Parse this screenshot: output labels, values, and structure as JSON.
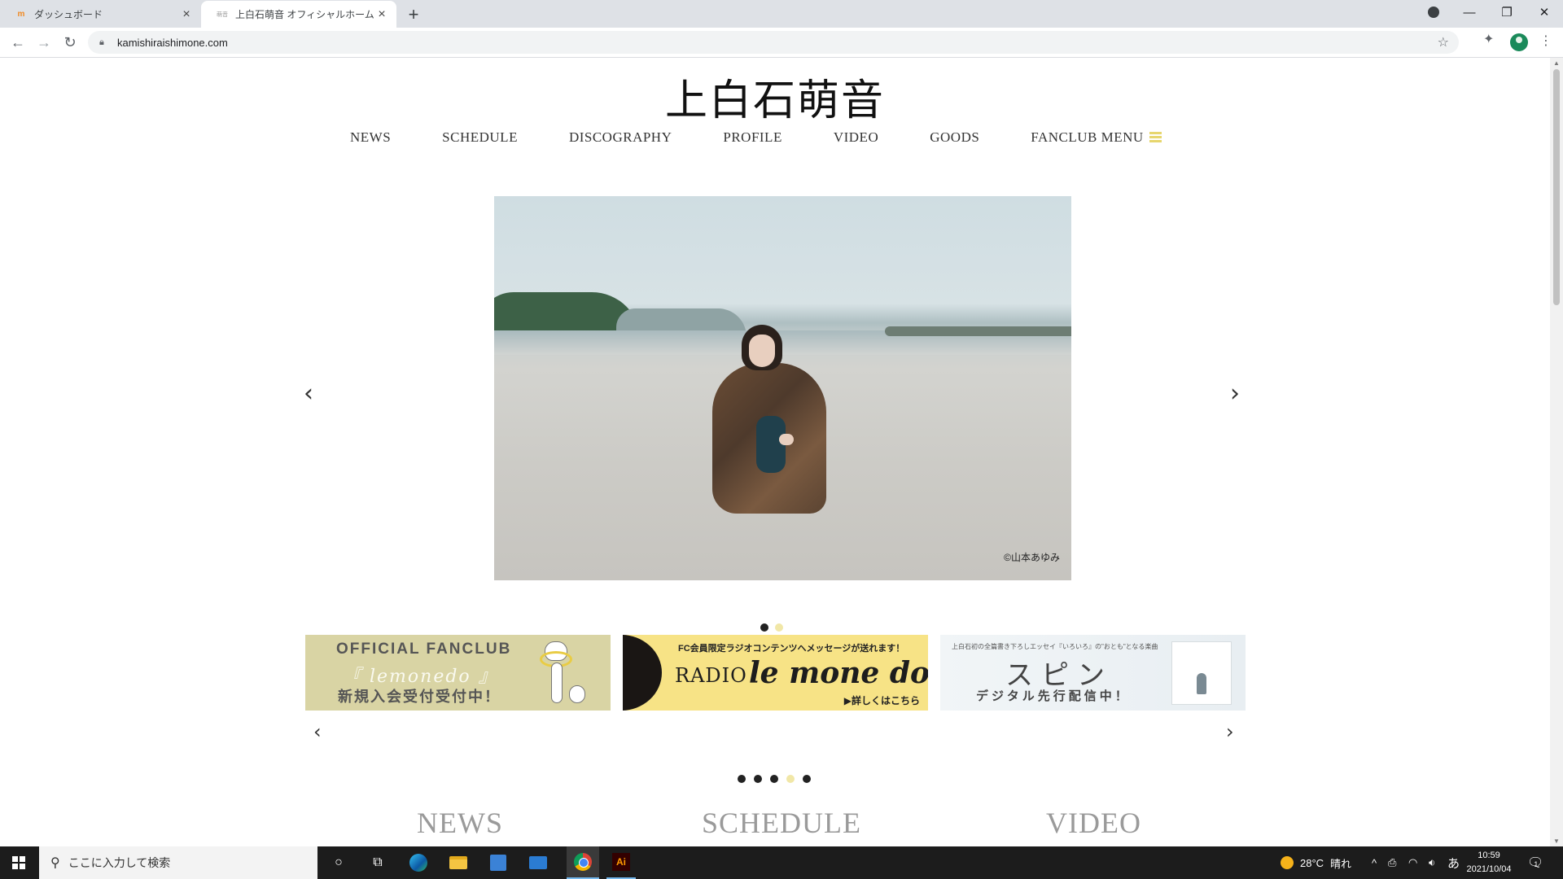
{
  "browser": {
    "tabs": [
      {
        "title": "ダッシュボード",
        "favicon": "wordpress-dashboard-icon"
      },
      {
        "title": "上白石萌音 オフィシャルホームページ",
        "favicon": "site-icon",
        "active": true
      }
    ],
    "url": "kamishiraishimone.com"
  },
  "site": {
    "logo": "上白石萌音",
    "nav": [
      "NEWS",
      "SCHEDULE",
      "DISCOGRAPHY",
      "PROFILE",
      "VIDEO",
      "GOODS",
      "FANCLUB MENU"
    ],
    "hero": {
      "credit": "©山本あゆみ",
      "slides": 2,
      "active_slide": 2
    },
    "banners": [
      {
        "id": "fanclub",
        "title": "OFFICIAL FANCLUB",
        "script": "『 lemonedo 』",
        "subtitle": "新規入会受付受付中！"
      },
      {
        "id": "radio",
        "top": "FC会員限定ラジオコンテンツへメッセージが送れます！",
        "word": "RADIO",
        "logo": "le mone do",
        "more": "▶詳しくはこちら"
      },
      {
        "id": "spin",
        "top": "上白石初の全篇書き下ろしエッセイ『いろいろ』の\"おとも\"となる楽曲",
        "title": "スピン",
        "subtitle": "デジタル先行配信中！"
      }
    ],
    "banner_pages": 5,
    "banner_active_page": 4,
    "sections": [
      "NEWS",
      "SCHEDULE",
      "VIDEO"
    ]
  },
  "taskbar": {
    "search_placeholder": "ここに入力して検索",
    "temperature": "28°C",
    "weather": "晴れ",
    "ime": "あ",
    "time": "10:59",
    "date": "2021/10/04",
    "notification_count": "1"
  },
  "colors": {
    "accent": "#e7d66e",
    "fanclub_banner": "#d9d4a4",
    "radio_banner": "#f7e386",
    "active_dot": "#f1e7a7"
  }
}
